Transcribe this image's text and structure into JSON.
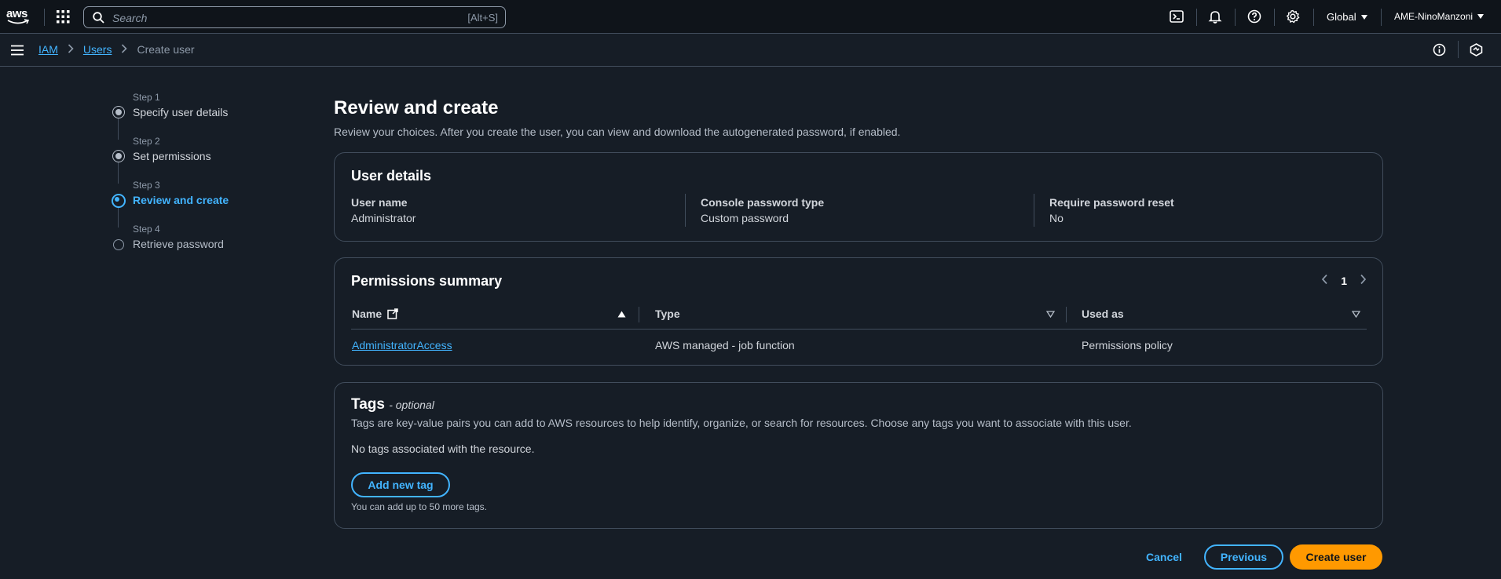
{
  "topbar": {
    "logo": "aws",
    "search_placeholder": "Search",
    "search_shortcut": "[Alt+S]",
    "icons": [
      "cloudshell-icon",
      "bell-icon",
      "help-icon",
      "gear-icon"
    ],
    "region": "Global",
    "account": "AME-NinoManzoni"
  },
  "breadcrumb": {
    "items": [
      "IAM",
      "Users",
      "Create user"
    ]
  },
  "wizard": {
    "steps": [
      {
        "num": "Step 1",
        "title": "Specify user details",
        "state": "done"
      },
      {
        "num": "Step 2",
        "title": "Set permissions",
        "state": "done"
      },
      {
        "num": "Step 3",
        "title": "Review and create",
        "state": "current"
      },
      {
        "num": "Step 4",
        "title": "Retrieve password",
        "state": "todo"
      }
    ]
  },
  "page": {
    "title": "Review and create",
    "description": "Review your choices. After you create the user, you can view and download the autogenerated password, if enabled."
  },
  "user_details": {
    "title": "User details",
    "fields": [
      {
        "label": "User name",
        "value": "Administrator"
      },
      {
        "label": "Console password type",
        "value": "Custom password"
      },
      {
        "label": "Require password reset",
        "value": "No"
      }
    ]
  },
  "permissions": {
    "title": "Permissions summary",
    "page": "1",
    "columns": [
      "Name",
      "Type",
      "Used as"
    ],
    "rows": [
      {
        "name": "AdministratorAccess",
        "type": "AWS managed - job function",
        "used_as": "Permissions policy"
      }
    ]
  },
  "tags": {
    "title": "Tags",
    "optional": "- optional",
    "description": "Tags are key-value pairs you can add to AWS resources to help identify, organize, or search for resources. Choose any tags you want to associate with this user.",
    "empty": "No tags associated with the resource.",
    "add_button": "Add new tag",
    "hint": "You can add up to 50 more tags."
  },
  "actions": {
    "cancel": "Cancel",
    "previous": "Previous",
    "create": "Create user"
  },
  "colors": {
    "accent": "#42b4ff",
    "primary_button": "#ff9900",
    "background": "#161d26"
  }
}
